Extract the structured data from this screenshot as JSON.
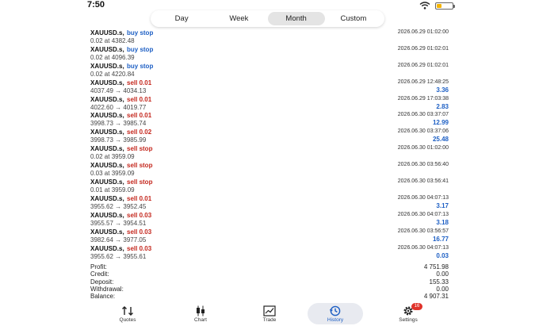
{
  "status_bar": {
    "time": "7:50"
  },
  "period_tabs": [
    {
      "label": "Day",
      "active": false
    },
    {
      "label": "Week",
      "active": false
    },
    {
      "label": "Month",
      "active": true
    },
    {
      "label": "Custom",
      "active": false
    }
  ],
  "deals": [
    {
      "symbol": "XAUUSD.s,",
      "type": "buy stop",
      "side": "buy",
      "prices": "0.02 at 4382.48",
      "time": "2026.06.29 01:02:00",
      "profit": ""
    },
    {
      "symbol": "XAUUSD.s,",
      "type": "buy stop",
      "side": "buy",
      "prices": "0.02 at 4096.39",
      "time": "2026.06.29 01:02:01",
      "profit": ""
    },
    {
      "symbol": "XAUUSD.s,",
      "type": "buy stop",
      "side": "buy",
      "prices": "0.02 at 4220.84",
      "time": "2026.06.29 01:02:01",
      "profit": ""
    },
    {
      "symbol": "XAUUSD.s,",
      "type": "sell 0.01",
      "side": "sell",
      "prices": "4037.49 → 4034.13",
      "time": "2026.06.29 12:48:25",
      "profit": "3.36"
    },
    {
      "symbol": "XAUUSD.s,",
      "type": "sell 0.01",
      "side": "sell",
      "prices": "4022.60 → 4019.77",
      "time": "2026.06.29 17:03:38",
      "profit": "2.83"
    },
    {
      "symbol": "XAUUSD.s,",
      "type": "sell 0.01",
      "side": "sell",
      "prices": "3998.73 → 3985.74",
      "time": "2026.06.30 03:37:07",
      "profit": "12.99"
    },
    {
      "symbol": "XAUUSD.s,",
      "type": "sell 0.02",
      "side": "sell",
      "prices": "3998.73 → 3985.99",
      "time": "2026.06.30 03:37:06",
      "profit": "25.48"
    },
    {
      "symbol": "XAUUSD.s,",
      "type": "sell stop",
      "side": "sell",
      "prices": "0.02 at 3959.09",
      "time": "2026.06.30 01:02:00",
      "profit": ""
    },
    {
      "symbol": "XAUUSD.s,",
      "type": "sell stop",
      "side": "sell",
      "prices": "0.03 at 3959.09",
      "time": "2026.06.30 03:56:40",
      "profit": ""
    },
    {
      "symbol": "XAUUSD.s,",
      "type": "sell stop",
      "side": "sell",
      "prices": "0.01 at 3959.09",
      "time": "2026.06.30 03:56:41",
      "profit": ""
    },
    {
      "symbol": "XAUUSD.s,",
      "type": "sell 0.01",
      "side": "sell",
      "prices": "3955.62 → 3952.45",
      "time": "2026.06.30 04:07:13",
      "profit": "3.17"
    },
    {
      "symbol": "XAUUSD.s,",
      "type": "sell 0.03",
      "side": "sell",
      "prices": "3955.57 → 3954.51",
      "time": "2026.06.30 04:07:13",
      "profit": "3.18"
    },
    {
      "symbol": "XAUUSD.s,",
      "type": "sell 0.03",
      "side": "sell",
      "prices": "3982.64 → 3977.05",
      "time": "2026.06.30 03:56:57",
      "profit": "16.77"
    },
    {
      "symbol": "XAUUSD.s,",
      "type": "sell 0.03",
      "side": "sell",
      "prices": "3955.62 → 3955.61",
      "time": "2026.06.30 04:07:13",
      "profit": "0.03"
    }
  ],
  "summary": [
    {
      "label": "Profit:",
      "value": "4 751.98"
    },
    {
      "label": "Credit:",
      "value": "0.00"
    },
    {
      "label": "Deposit:",
      "value": "155.33"
    },
    {
      "label": "Withdrawal:",
      "value": "0.00"
    },
    {
      "label": "Balance:",
      "value": "4 907.31"
    }
  ],
  "tab_bar": [
    {
      "label": "Quotes",
      "icon": "quotes-icon",
      "active": false
    },
    {
      "label": "Chart",
      "icon": "chart-icon",
      "active": false
    },
    {
      "label": "Trade",
      "icon": "trade-icon",
      "active": false
    },
    {
      "label": "History",
      "icon": "history-icon",
      "active": true
    },
    {
      "label": "Settings",
      "icon": "settings-icon",
      "active": false,
      "badge": "16"
    }
  ],
  "colors": {
    "buy": "#1d5fc4",
    "sell": "#c4271d",
    "profit": "#1d5fc4",
    "badge": "#e0332b"
  }
}
